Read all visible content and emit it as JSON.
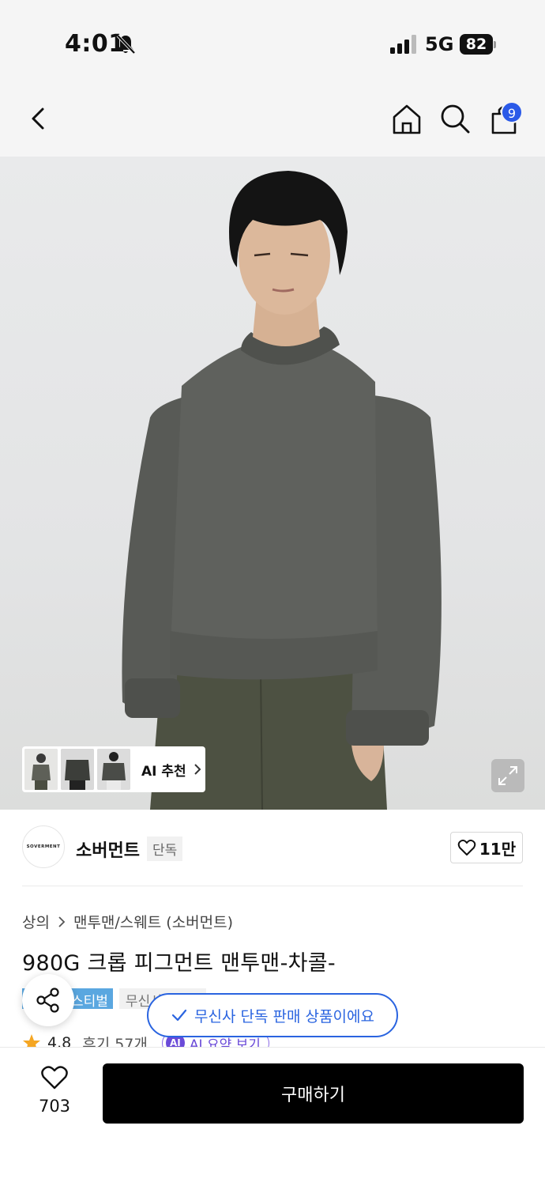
{
  "status_bar": {
    "time": "4:01",
    "network": "5G",
    "battery": "82",
    "icons": [
      "bell-off-icon",
      "cellular-signal-icon",
      "battery-icon"
    ]
  },
  "nav": {
    "icons": [
      "back-chevron-icon",
      "home-icon",
      "search-icon",
      "cart-icon"
    ],
    "cart_count": "9"
  },
  "hero": {
    "ai_recommend_label": "AI 추천",
    "ai_thumbnail_count": 3,
    "icons": [
      "chevron-right-icon",
      "expand-icon"
    ]
  },
  "brand": {
    "logo_text": "SOVERMENT",
    "name": "소버먼트",
    "tag": "단독",
    "like_count": "11만",
    "icons": [
      "heart-outline-icon"
    ]
  },
  "breadcrumb": {
    "items": [
      "상의",
      "맨투맨/스웨트 (소버먼트)"
    ],
    "icons": [
      "chevron-right-icon"
    ]
  },
  "product": {
    "title": "980G 크롭 피그먼트 맨투맨-차콜-",
    "badge_festival": "스티벌",
    "badge_musinsa": "무신사스토어",
    "rating": "4.8",
    "review": "후기 57개",
    "ai_summary_icon_text": "AI",
    "ai_summary": "AI 요약 보기"
  },
  "overlay": {
    "exclusive_toast": "무신사 단독 판매 상품이에요",
    "icons": [
      "share-icon",
      "check-icon"
    ]
  },
  "bottom": {
    "wish_count": "703",
    "buy_label": "구매하기",
    "icons": [
      "heart-outline-icon"
    ]
  },
  "colors": {
    "accent_blue": "#2a64e0",
    "badge_blue": "#5aa7e0",
    "ai_purple": "#6a4ad8",
    "buy_button": "#000000",
    "star": "#f5a623"
  }
}
